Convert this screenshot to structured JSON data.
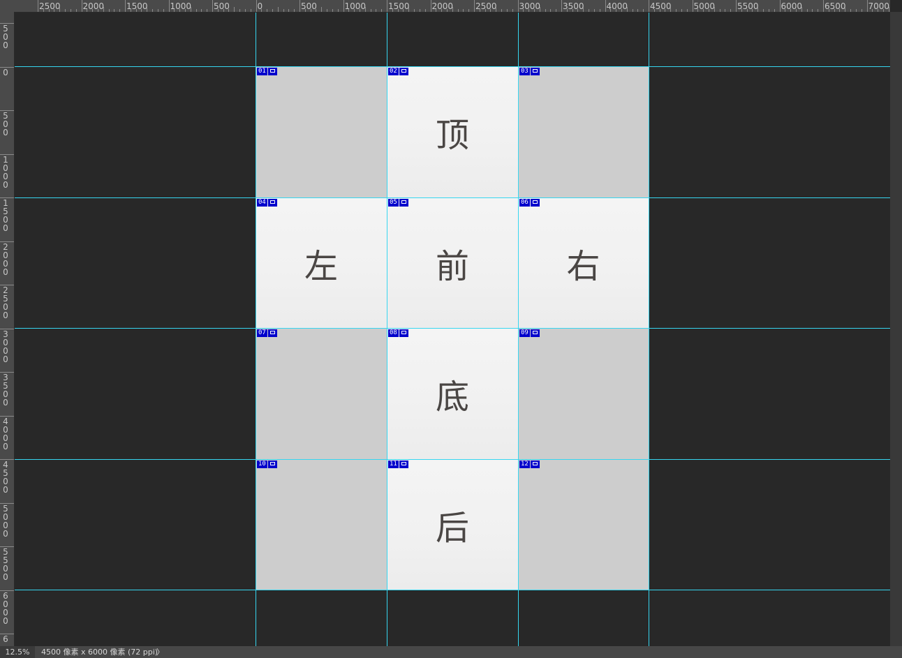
{
  "rulers": {
    "top": [
      "2500",
      "2000",
      "1500",
      "1000",
      "500",
      "0",
      "500",
      "1000",
      "1500",
      "2000",
      "2500",
      "3000",
      "3500",
      "4000",
      "4500",
      "5000",
      "5500",
      "6000",
      "6500",
      "7000"
    ],
    "left": [
      "500",
      "0",
      "500",
      "1000",
      "1500",
      "2000",
      "2500",
      "3000",
      "3500",
      "4000",
      "4500",
      "5000",
      "5500",
      "6000",
      "6"
    ]
  },
  "slices": [
    {
      "num": "01",
      "label": "",
      "photo": false
    },
    {
      "num": "02",
      "label": "顶",
      "photo": true
    },
    {
      "num": "03",
      "label": "",
      "photo": false
    },
    {
      "num": "04",
      "label": "左",
      "photo": true
    },
    {
      "num": "05",
      "label": "前",
      "photo": true
    },
    {
      "num": "06",
      "label": "右",
      "photo": true
    },
    {
      "num": "07",
      "label": "",
      "photo": false
    },
    {
      "num": "08",
      "label": "底",
      "photo": true
    },
    {
      "num": "09",
      "label": "",
      "photo": false
    },
    {
      "num": "10",
      "label": "",
      "photo": false
    },
    {
      "num": "11",
      "label": "后",
      "photo": true
    },
    {
      "num": "12",
      "label": "",
      "photo": false
    }
  ],
  "status": {
    "zoom": "12.5%",
    "doc_info": "4500 像素 x 6000 像素 (72 ppi)",
    "arrow": "〉"
  },
  "colors": {
    "guide": "#36d6f0",
    "slice_badge": "#0000cc",
    "empty_tile": "#cdcdcd"
  }
}
